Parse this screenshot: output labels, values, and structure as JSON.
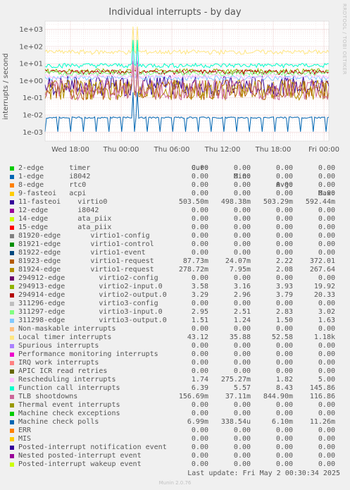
{
  "title": "Individual interrupts - by day",
  "ylabel": "interrupts / second",
  "watermark": "RRDTOOL / TOBI OETIKER",
  "last_update": "Last update: Fri May  2 00:30:34 2025",
  "munin": "Munin 2.0.76",
  "legend_header": {
    "cur": "Cur:",
    "min": "Min:",
    "avg": "Avg:",
    "max": "Max:"
  },
  "chart_data": {
    "type": "line",
    "title": "Individual interrupts - by day",
    "ylabel": "interrupts / second",
    "yscale": "log",
    "ylim": [
      0.0003,
      3000
    ],
    "yticks": [
      "1e-03",
      "1e-02",
      "1e-01",
      "1e+00",
      "1e+01",
      "1e+02",
      "1e+03"
    ],
    "xticks": [
      "Wed 18:00",
      "Thu 00:00",
      "Thu 06:00",
      "Thu 12:00",
      "Thu 18:00",
      "Fri 00:00"
    ],
    "x_range_hours": [
      13.5,
      24.5
    ],
    "grid": true,
    "series": [
      {
        "name": "2-edge      timer",
        "color": "#00cc00",
        "cur": "0.00",
        "min": "0.00",
        "avg": "0.00",
        "max": "0.00"
      },
      {
        "name": "1-edge      i8042",
        "color": "#0066b3",
        "cur": "0.00",
        "min": "0.00",
        "avg": "0.00",
        "max": "0.00"
      },
      {
        "name": "8-edge      rtc0",
        "color": "#ff8000",
        "cur": "0.00",
        "min": "0.00",
        "avg": "0.00",
        "max": "0.00"
      },
      {
        "name": "9-fasteoi   acpi",
        "color": "#ffcc00",
        "cur": "0.00",
        "min": "0.00",
        "avg": "0.00",
        "max": "0.00"
      },
      {
        "name": "11-fasteoi    virtio0",
        "color": "#330099",
        "cur": "503.50m",
        "min": "498.38m",
        "avg": "503.29m",
        "max": "592.44m",
        "level": 0.5
      },
      {
        "name": "12-edge       i8042",
        "color": "#990099",
        "cur": "0.00",
        "min": "0.00",
        "avg": "0.00",
        "max": "0.00"
      },
      {
        "name": "14-edge       ata_piix",
        "color": "#ccff00",
        "cur": "0.00",
        "min": "0.00",
        "avg": "0.00",
        "max": "0.00"
      },
      {
        "name": "15-edge       ata_piix",
        "color": "#ff0000",
        "cur": "0.00",
        "min": "0.00",
        "avg": "0.00",
        "max": "0.00"
      },
      {
        "name": "81920-edge       virtio1-config",
        "color": "#808080",
        "cur": "0.00",
        "min": "0.00",
        "avg": "0.00",
        "max": "0.00"
      },
      {
        "name": "81921-edge       virtio1-control",
        "color": "#008f00",
        "cur": "0.00",
        "min": "0.00",
        "avg": "0.00",
        "max": "0.00"
      },
      {
        "name": "81922-edge       virtio1-event",
        "color": "#00487d",
        "cur": "0.00",
        "min": "0.00",
        "avg": "0.00",
        "max": "0.00"
      },
      {
        "name": "81923-edge       virtio1-request",
        "color": "#b35a00",
        "cur": "87.73m",
        "min": "24.07m",
        "avg": "2.22",
        "max": "372.01",
        "level": 0.3
      },
      {
        "name": "81924-edge       virtio1-request",
        "color": "#b38f00",
        "cur": "278.72m",
        "min": "7.95m",
        "avg": "2.08",
        "max": "267.64",
        "level": 0.3
      },
      {
        "name": "294912-edge        virtio2-config",
        "color": "#6b006b",
        "cur": "0.00",
        "min": "0.00",
        "avg": "0.00",
        "max": "0.00"
      },
      {
        "name": "294913-edge        virtio2-input.0",
        "color": "#8fb300",
        "cur": "3.58",
        "min": "3.16",
        "avg": "3.93",
        "max": "19.92",
        "level": 3.8
      },
      {
        "name": "294914-edge        virtio2-output.0",
        "color": "#b30000",
        "cur": "3.29",
        "min": "2.96",
        "avg": "3.79",
        "max": "20.33",
        "level": 3.3
      },
      {
        "name": "311296-edge        virtio3-config",
        "color": "#bebebe",
        "cur": "0.00",
        "min": "0.00",
        "avg": "0.00",
        "max": "0.00"
      },
      {
        "name": "311297-edge        virtio3-input.0",
        "color": "#80ff80",
        "cur": "2.95",
        "min": "2.51",
        "avg": "2.83",
        "max": "3.02",
        "level": 2.8
      },
      {
        "name": "311298-edge        virtio3-output.0",
        "color": "#80c9ff",
        "cur": "1.51",
        "min": "1.24",
        "avg": "1.50",
        "max": "1.63",
        "level": 1.5
      },
      {
        "name": "Non-maskable interrupts",
        "color": "#ffc080",
        "cur": "0.00",
        "min": "0.00",
        "avg": "0.00",
        "max": "0.00"
      },
      {
        "name": "Local timer interrupts",
        "color": "#ffe680",
        "cur": "43.12",
        "min": "35.88",
        "avg": "52.58",
        "max": "1.18k",
        "level": 48
      },
      {
        "name": "Spurious interrupts",
        "color": "#aa80ff",
        "cur": "0.00",
        "min": "0.00",
        "avg": "0.00",
        "max": "0.00"
      },
      {
        "name": "Performance monitoring interrupts",
        "color": "#ee00cc",
        "cur": "0.00",
        "min": "0.00",
        "avg": "0.00",
        "max": "0.00"
      },
      {
        "name": "IRQ work interrupts",
        "color": "#ff8080",
        "cur": "0.00",
        "min": "0.00",
        "avg": "0.00",
        "max": "0.00"
      },
      {
        "name": "APIC ICR read retries",
        "color": "#666600",
        "cur": "0.00",
        "min": "0.00",
        "avg": "0.00",
        "max": "0.00"
      },
      {
        "name": "Rescheduling interrupts",
        "color": "#ffbfff",
        "cur": "1.74",
        "min": "275.27m",
        "avg": "1.82",
        "max": "5.00",
        "level": 1.8
      },
      {
        "name": "Function call interrupts",
        "color": "#00ffcc",
        "cur": "6.39",
        "min": "5.57",
        "avg": "8.43",
        "max": "145.86",
        "level": 8
      },
      {
        "name": "TLB shootdowns",
        "color": "#cc6699",
        "cur": "156.69m",
        "min": "37.11m",
        "avg": "844.90m",
        "max": "116.86",
        "level": 0.3
      },
      {
        "name": "Thermal event interrupts",
        "color": "#999900",
        "cur": "0.00",
        "min": "0.00",
        "avg": "0.00",
        "max": "0.00"
      },
      {
        "name": "Machine check exceptions",
        "color": "#00cc00",
        "cur": "0.00",
        "min": "0.00",
        "avg": "0.00",
        "max": "0.00"
      },
      {
        "name": "Machine check polls",
        "color": "#0066b3",
        "cur": "6.99m",
        "min": "338.54u",
        "avg": "6.10m",
        "max": "11.26m",
        "level": 0.007
      },
      {
        "name": "ERR",
        "color": "#ff8000",
        "cur": "0.00",
        "min": "0.00",
        "avg": "0.00",
        "max": "0.00"
      },
      {
        "name": "MIS",
        "color": "#ffcc00",
        "cur": "0.00",
        "min": "0.00",
        "avg": "0.00",
        "max": "0.00"
      },
      {
        "name": "Posted-interrupt notification event",
        "color": "#330099",
        "cur": "0.00",
        "min": "0.00",
        "avg": "0.00",
        "max": "0.00"
      },
      {
        "name": "Nested posted-interrupt event",
        "color": "#990099",
        "cur": "0.00",
        "min": "0.00",
        "avg": "0.00",
        "max": "0.00"
      },
      {
        "name": "Posted-interrupt wakeup event",
        "color": "#ccff00",
        "cur": "0.00",
        "min": "0.00",
        "avg": "0.00",
        "max": "0.00"
      }
    ]
  }
}
